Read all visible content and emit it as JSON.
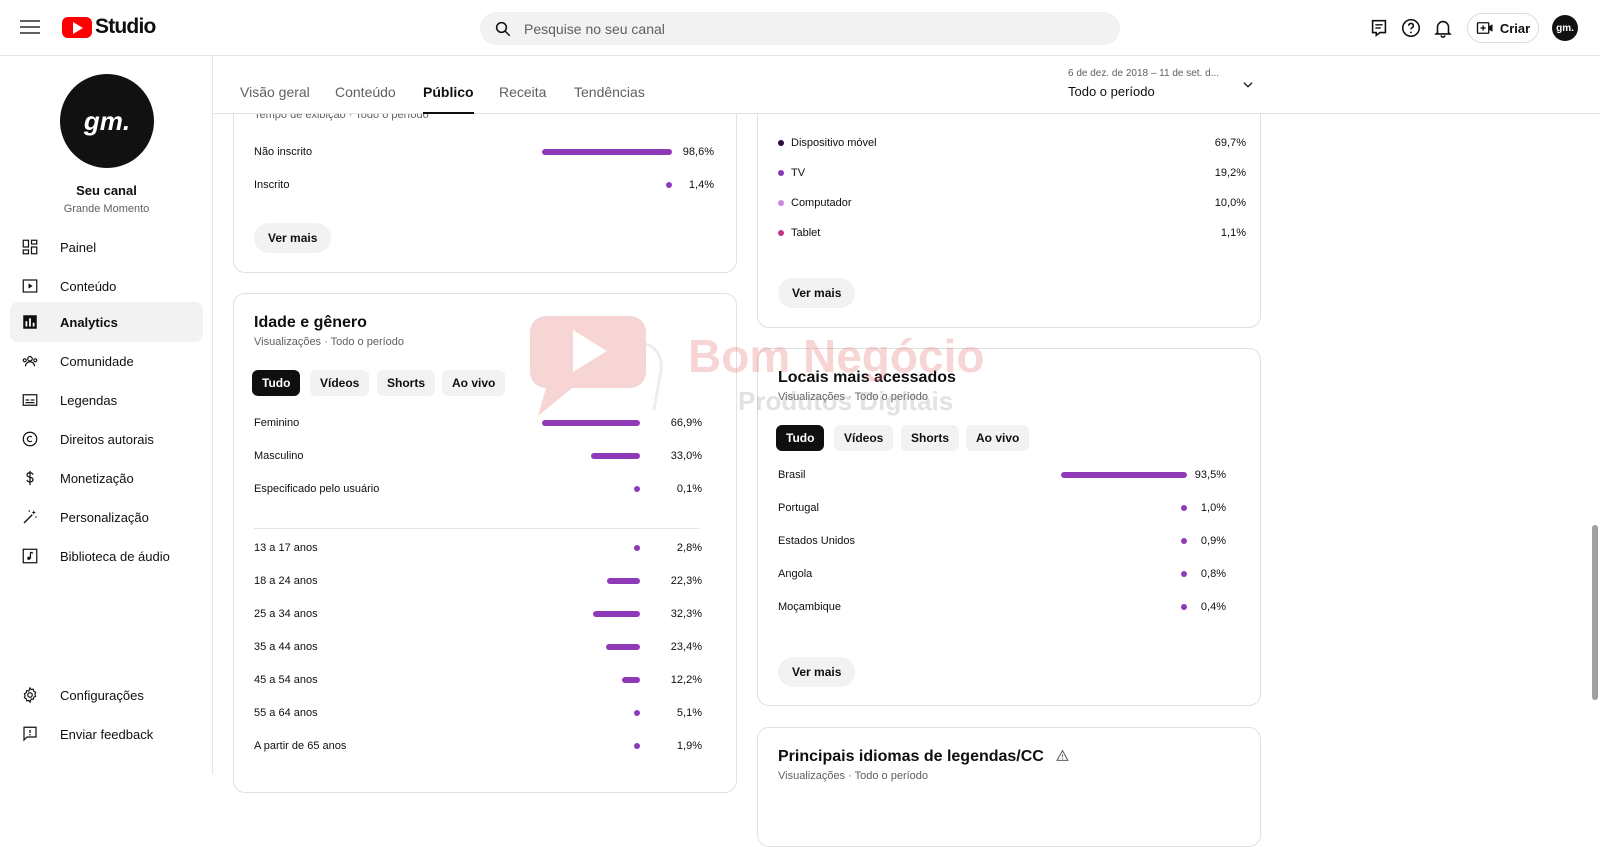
{
  "header": {
    "logo_text": "Studio",
    "search_placeholder": "Pesquise no seu canal",
    "create_label": "Criar",
    "avatar_text": "gm."
  },
  "sidebar": {
    "channel_avatar_text": "gm.",
    "channel_name": "Seu canal",
    "channel_sub": "Grande Momento",
    "items": [
      {
        "label": "Painel",
        "icon": "dashboard-icon"
      },
      {
        "label": "Conteúdo",
        "icon": "content-icon"
      },
      {
        "label": "Analytics",
        "icon": "analytics-icon",
        "active": true
      },
      {
        "label": "Comunidade",
        "icon": "community-icon"
      },
      {
        "label": "Legendas",
        "icon": "subtitles-icon"
      },
      {
        "label": "Direitos autorais",
        "icon": "copyright-icon"
      },
      {
        "label": "Monetização",
        "icon": "dollar-icon"
      },
      {
        "label": "Personalização",
        "icon": "magic-wand-icon"
      },
      {
        "label": "Biblioteca de áudio",
        "icon": "audio-library-icon"
      }
    ],
    "bottom_items": [
      {
        "label": "Configurações",
        "icon": "gear-icon"
      },
      {
        "label": "Enviar feedback",
        "icon": "feedback-icon"
      }
    ]
  },
  "tabs": [
    "Visão geral",
    "Conteúdo",
    "Público",
    "Receita",
    "Tendências"
  ],
  "active_tab": "Público",
  "period": {
    "range": "6 de dez. de 2018 – 11 de set. d...",
    "label": "Todo o período"
  },
  "subscription_card": {
    "sub_cut": "Tempo de exibição · Todo o período",
    "rows": [
      {
        "label": "Não inscrito",
        "pct": "98,6%",
        "value": 98.6
      },
      {
        "label": "Inscrito",
        "pct": "1,4%",
        "value": 1.4
      }
    ],
    "more_label": "Ver mais"
  },
  "age_gender_card": {
    "title": "Idade e gênero",
    "subtitle": "Visualizações · Todo o período",
    "chips": [
      "Tudo",
      "Vídeos",
      "Shorts",
      "Ao vivo"
    ],
    "gender_rows": [
      {
        "label": "Feminino",
        "pct": "66,9%",
        "value": 66.9
      },
      {
        "label": "Masculino",
        "pct": "33,0%",
        "value": 33.0
      },
      {
        "label": "Especificado pelo usuário",
        "pct": "0,1%",
        "value": 0.1
      }
    ],
    "age_rows": [
      {
        "label": "13 a 17 anos",
        "pct": "2,8%",
        "value": 2.8
      },
      {
        "label": "18 a 24 anos",
        "pct": "22,3%",
        "value": 22.3
      },
      {
        "label": "25 a 34 anos",
        "pct": "32,3%",
        "value": 32.3
      },
      {
        "label": "35 a 44 anos",
        "pct": "23,4%",
        "value": 23.4
      },
      {
        "label": "45 a 54 anos",
        "pct": "12,2%",
        "value": 12.2
      },
      {
        "label": "55 a 64 anos",
        "pct": "5,1%",
        "value": 5.1
      },
      {
        "label": "A partir de 65 anos",
        "pct": "1,9%",
        "value": 1.9
      }
    ]
  },
  "device_card": {
    "rows": [
      {
        "label": "Dispositivo móvel",
        "pct": "69,7%",
        "color": "#2d0a3e"
      },
      {
        "label": "TV",
        "pct": "19,2%",
        "color": "#8e3ab8"
      },
      {
        "label": "Computador",
        "pct": "10,0%",
        "color": "#c88ae0"
      },
      {
        "label": "Tablet",
        "pct": "1,1%",
        "color": "#c2358a"
      }
    ],
    "more_label": "Ver mais"
  },
  "locations_card": {
    "title": "Locais mais acessados",
    "subtitle": "Visualizações · Todo o período",
    "chips": [
      "Tudo",
      "Vídeos",
      "Shorts",
      "Ao vivo"
    ],
    "rows": [
      {
        "label": "Brasil",
        "pct": "93,5%",
        "value": 93.5
      },
      {
        "label": "Portugal",
        "pct": "1,0%",
        "value": 1.0
      },
      {
        "label": "Estados Unidos",
        "pct": "0,9%",
        "value": 0.9
      },
      {
        "label": "Angola",
        "pct": "0,8%",
        "value": 0.8
      },
      {
        "label": "Moçambique",
        "pct": "0,4%",
        "value": 0.4
      }
    ],
    "more_label": "Ver mais"
  },
  "languages_card": {
    "title": "Principais idiomas de legendas/CC",
    "subtitle": "Visualizações · Todo o período"
  },
  "watermark": {
    "line1": "Bom Negócio",
    "line2": "Produtos Digitais"
  },
  "colors": {
    "bar": "#8e3ab8",
    "brand_red": "#ff0000"
  }
}
